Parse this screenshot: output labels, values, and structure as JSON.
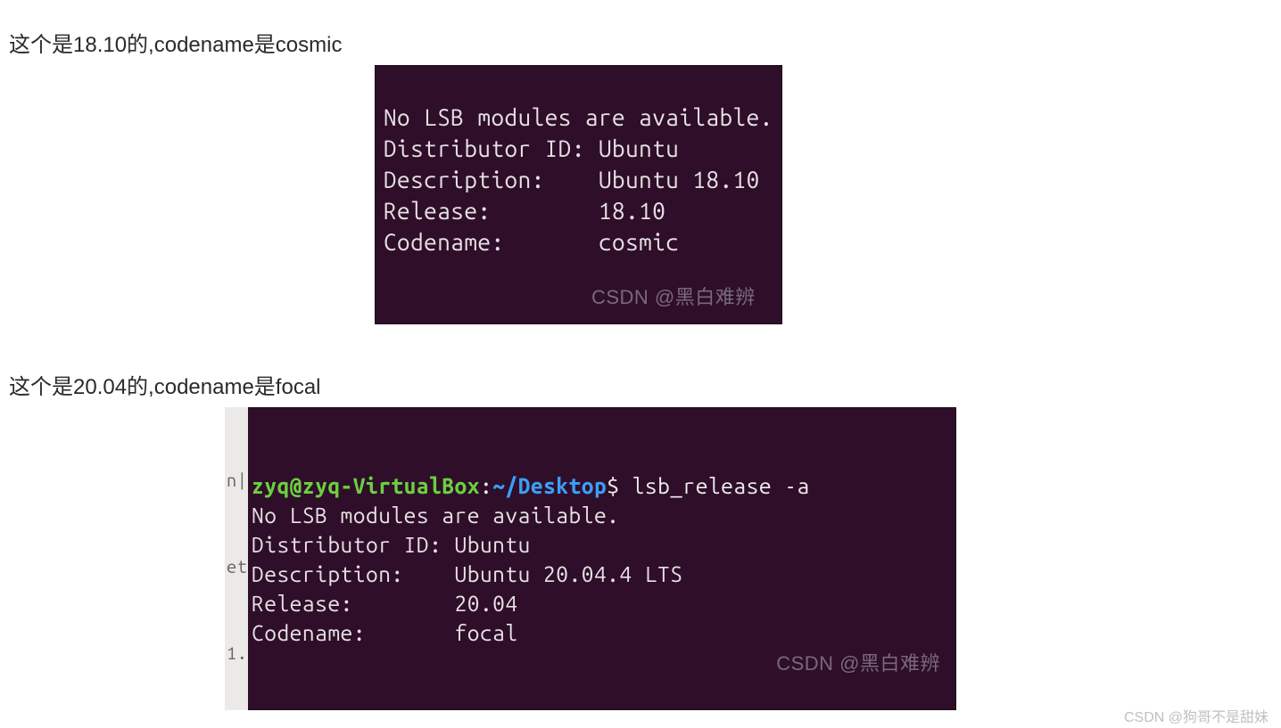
{
  "caption1": "这个是18.10的,codename是cosmic",
  "caption2": "这个是20.04的,codename是focal",
  "terminal1": {
    "lines": [
      "No LSB modules are available.",
      "Distributor ID: Ubuntu",
      "Description:    Ubuntu 18.10",
      "Release:        18.10",
      "Codename:       cosmic"
    ],
    "watermark": "CSDN @黑白难辨"
  },
  "terminal2": {
    "prompt_user": "zyq@zyq-VirtualBox",
    "prompt_sep1": ":",
    "prompt_path": "~/Desktop",
    "prompt_sep2": "$ ",
    "command": "lsb_release -a",
    "left_edge": [
      "n|",
      "et",
      "1."
    ],
    "lines": [
      "No LSB modules are available.",
      "Distributor ID: Ubuntu",
      "Description:    Ubuntu 20.04.4 LTS",
      "Release:        20.04",
      "Codename:       focal"
    ],
    "watermark": "CSDN @黑白难辨"
  },
  "page_watermark": "CSDN @狗哥不是甜妹"
}
